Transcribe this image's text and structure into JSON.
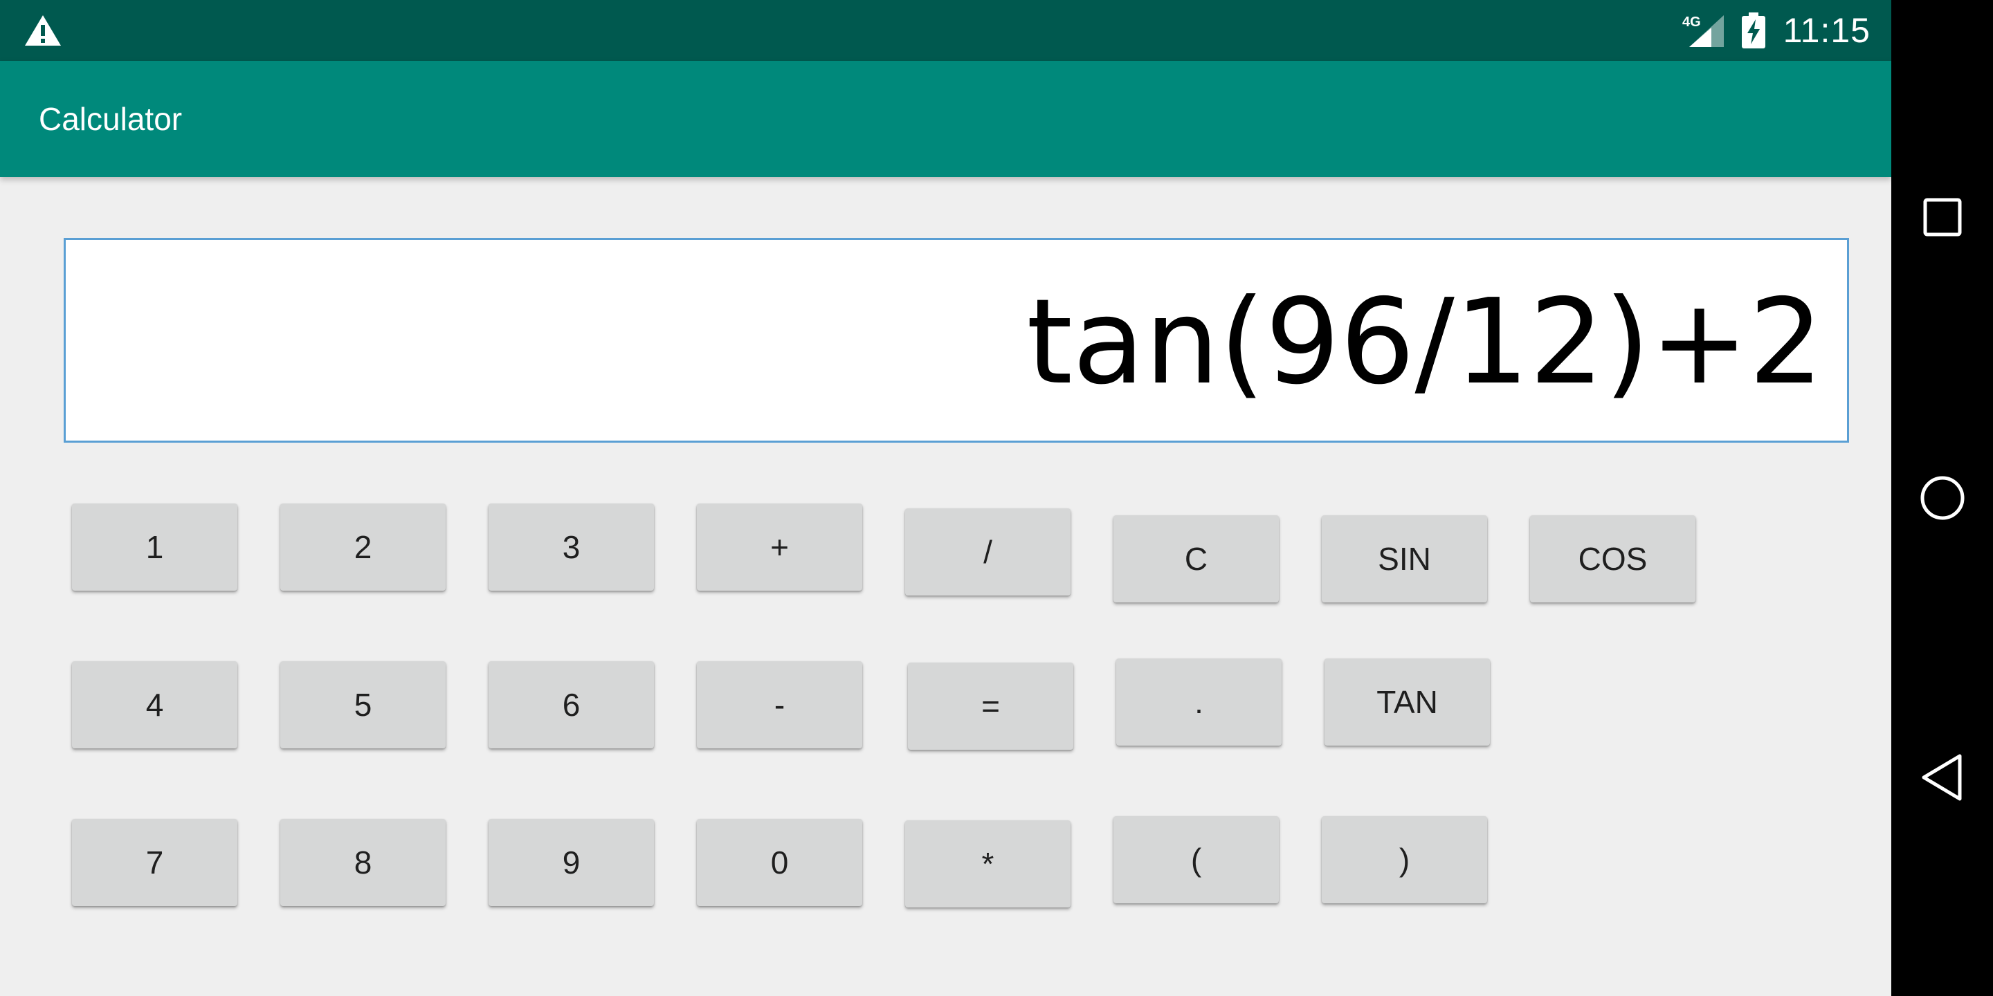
{
  "status_bar": {
    "time": "11:15",
    "network": "4G",
    "icons": [
      "warning-icon",
      "signal-icon",
      "battery-charging-icon"
    ]
  },
  "app_bar": {
    "title": "Calculator"
  },
  "display": {
    "expression": "tan(96/12)+2"
  },
  "keys": {
    "k1": "1",
    "k2": "2",
    "k3": "3",
    "plus": "+",
    "divide": "/",
    "clear": "C",
    "sin": "SIN",
    "cos": "COS",
    "k4": "4",
    "k5": "5",
    "k6": "6",
    "minus": "-",
    "equals": "=",
    "dot": ".",
    "tan": "TAN",
    "k7": "7",
    "k8": "8",
    "k9": "9",
    "k0": "0",
    "multiply": "*",
    "lparen": "(",
    "rparen": ")"
  },
  "nav_bar": {
    "icons": [
      "recents-square-icon",
      "home-circle-icon",
      "back-triangle-icon"
    ]
  },
  "colors": {
    "status_bar": "#00594f",
    "app_bar": "#00897b",
    "display_border": "#5a9fd4",
    "key_bg": "#d6d7d7",
    "background": "#efefef"
  }
}
